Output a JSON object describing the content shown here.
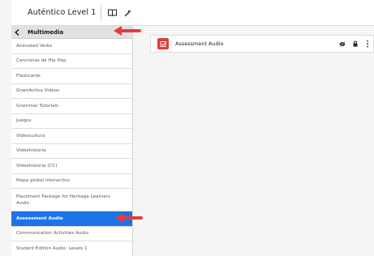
{
  "header": {
    "app_title": "Auténtico Level 1"
  },
  "sidebar": {
    "section_title": "Multimedia",
    "items": [
      {
        "label": "Animated Verbs",
        "active": false
      },
      {
        "label": "Canciones de Hip Hop",
        "active": false
      },
      {
        "label": "Flashcards",
        "active": false
      },
      {
        "label": "GramActiva Videos",
        "active": false
      },
      {
        "label": "Grammar Tutorials",
        "active": false
      },
      {
        "label": "Juegos",
        "active": false
      },
      {
        "label": "Videocultura",
        "active": false
      },
      {
        "label": "Videohistoria",
        "active": false
      },
      {
        "label": "Videohistoria (CC)",
        "active": false
      },
      {
        "label": "Mapa global interactivo",
        "active": false
      },
      {
        "label": "Placement Package for Heritage Learners Audio",
        "active": false
      },
      {
        "label": "Assessment Audio",
        "active": true
      },
      {
        "label": "Communication Activities Audio",
        "active": false
      },
      {
        "label": "Student Edition Audio: Levels 1",
        "active": false
      }
    ]
  },
  "main": {
    "asset": {
      "title": "Assessment Audio",
      "icon": "assignment-check-icon"
    }
  },
  "colors": {
    "accent_blue": "#1c73e8",
    "asset_red": "#e23c3c",
    "annotation_arrow": "#e43d3d"
  },
  "icons": {
    "toolbar": [
      "book-icon",
      "wrench-icon"
    ],
    "asset_actions": [
      "visibility-off-icon",
      "lock-icon",
      "more-vert-icon"
    ],
    "header": "chevron-left-icon"
  }
}
